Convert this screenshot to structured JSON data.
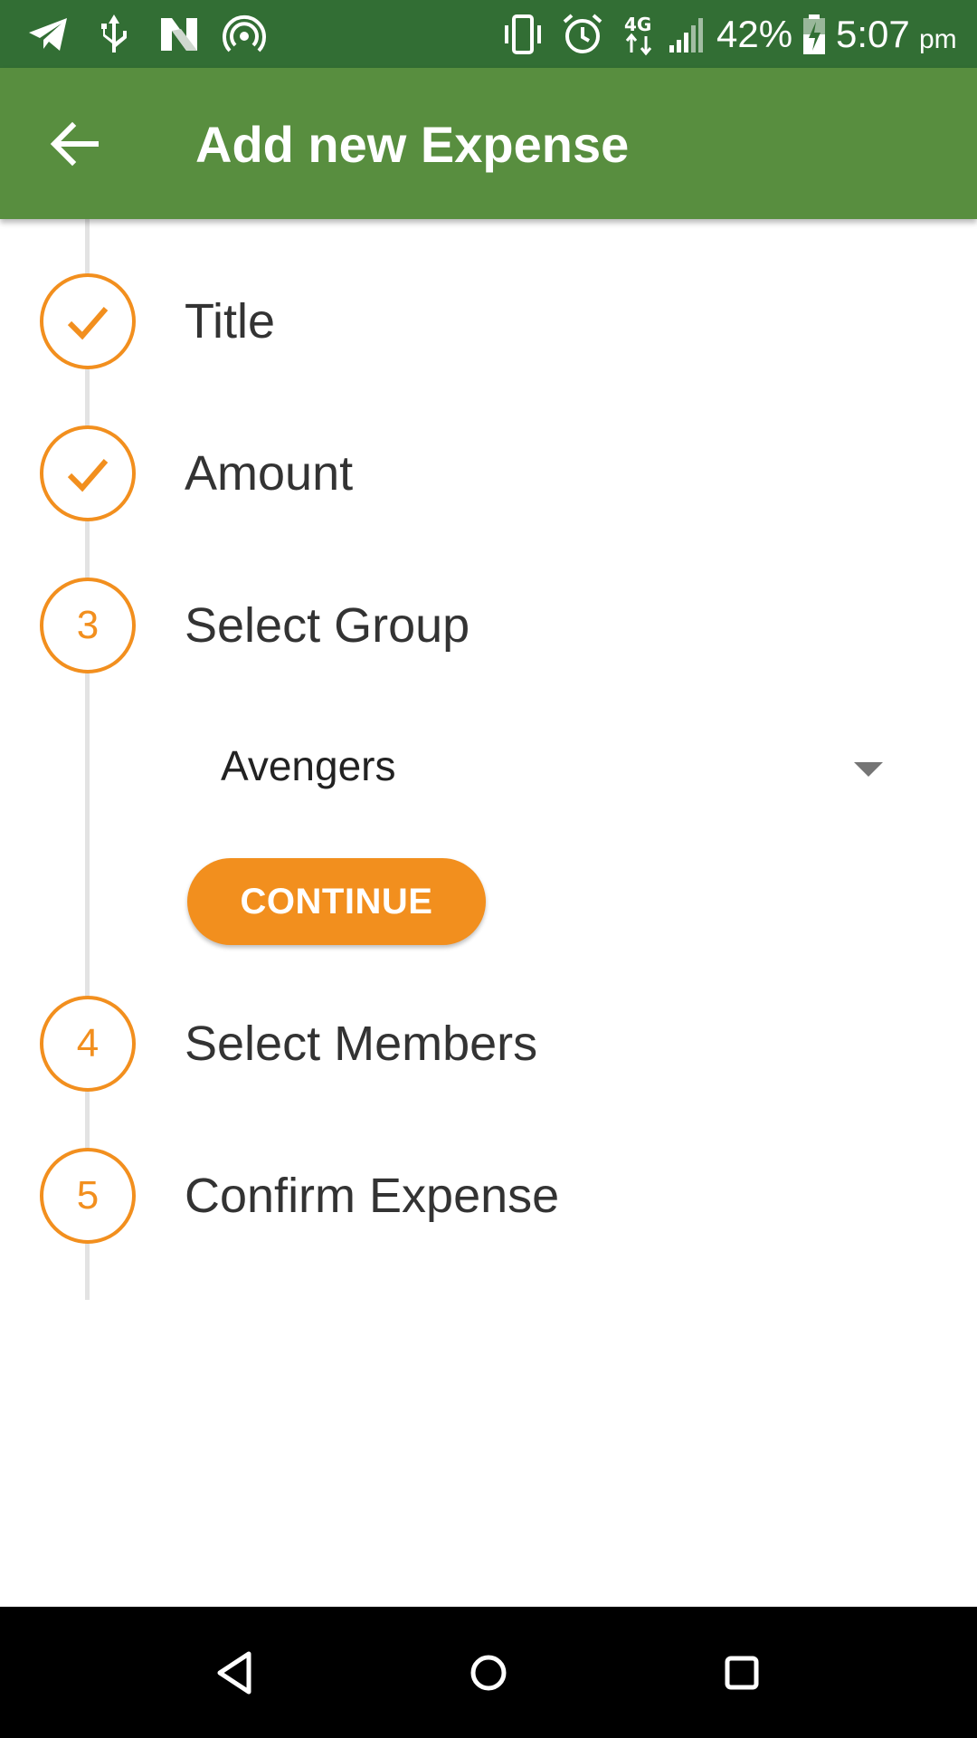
{
  "status_bar": {
    "battery_percent": "42%",
    "time": "5:07",
    "time_suffix": "pm",
    "icons": [
      "telegram-icon",
      "usb-icon",
      "n-app-icon",
      "hotspot-icon",
      "vibrate-icon",
      "alarm-icon",
      "4g-data-icon",
      "signal-icon",
      "battery-icon"
    ]
  },
  "app_bar": {
    "title": "Add new Expense",
    "back_icon": "arrow-back-icon"
  },
  "stepper": {
    "steps": [
      {
        "number": "1",
        "label": "Title",
        "state": "done"
      },
      {
        "number": "2",
        "label": "Amount",
        "state": "done"
      },
      {
        "number": "3",
        "label": "Select Group",
        "state": "active"
      },
      {
        "number": "4",
        "label": "Select Members",
        "state": "pending"
      },
      {
        "number": "5",
        "label": "Confirm Expense",
        "state": "pending"
      }
    ],
    "group_dropdown": {
      "selected": "Avengers"
    },
    "continue_label": "CONTINUE"
  },
  "colors": {
    "status_bar": "#326e34",
    "app_bar": "#588e3f",
    "accent": "#f28f1e",
    "text": "#333333"
  },
  "nav_bar": {
    "icons": [
      "back-triangle-icon",
      "home-circle-icon",
      "recents-square-icon"
    ]
  }
}
